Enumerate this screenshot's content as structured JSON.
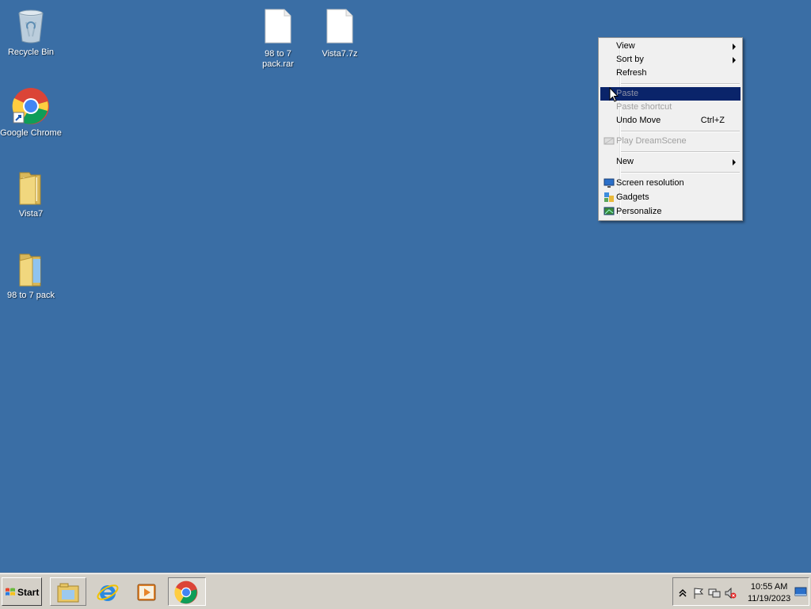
{
  "desktop": {
    "background_color": "#3a6ea5",
    "icons": [
      {
        "label": "Recycle Bin",
        "icon": "recycle-bin-icon"
      },
      {
        "label": "Google Chrome",
        "icon": "chrome-shortcut-icon"
      },
      {
        "label": "Vista7",
        "icon": "folder-icon"
      },
      {
        "label": "98 to 7 pack",
        "icon": "folder-icon"
      },
      {
        "label": "98 to 7\npack.rar",
        "icon": "file-icon"
      },
      {
        "label": "Vista7.7z",
        "icon": "file-icon"
      }
    ]
  },
  "context_menu": {
    "items": [
      {
        "label": "View",
        "submenu": true
      },
      {
        "label": "Sort by",
        "submenu": true
      },
      {
        "label": "Refresh"
      },
      {
        "label": "Paste",
        "disabled": true,
        "highlighted": true
      },
      {
        "label": "Paste shortcut",
        "disabled": true
      },
      {
        "label": "Undo Move",
        "shortcut": "Ctrl+Z"
      },
      {
        "label": "Play DreamScene",
        "disabled": true,
        "icon": "dreamscene-icon"
      },
      {
        "label": "New",
        "submenu": true
      },
      {
        "label": "Screen resolution",
        "icon": "screen-resolution-icon"
      },
      {
        "label": "Gadgets",
        "icon": "gadgets-icon"
      },
      {
        "label": "Personalize",
        "icon": "personalize-icon"
      }
    ],
    "highlight_color": "#0a246a"
  },
  "taskbar": {
    "start_label": "Start",
    "pinned": [
      {
        "icon": "file-explorer-icon"
      },
      {
        "icon": "internet-explorer-icon"
      },
      {
        "icon": "media-player-icon"
      },
      {
        "icon": "chrome-icon",
        "active": true
      }
    ],
    "tray": {
      "icons": [
        "show-hidden-icons-icon",
        "action-center-flag-icon",
        "network-icon",
        "volume-muted-icon"
      ],
      "time": "10:55 AM",
      "date": "11/19/2023",
      "show_desktop_icon": "show-desktop-icon"
    }
  }
}
